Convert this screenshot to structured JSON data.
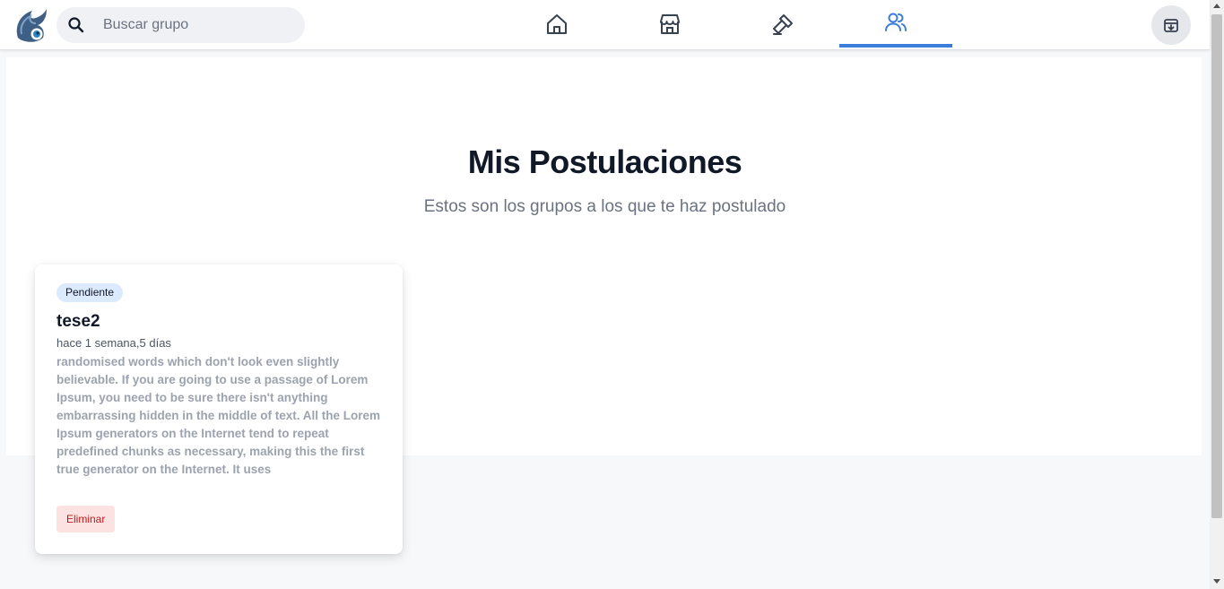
{
  "navbar": {
    "logo_icon": "dragon-logo-icon",
    "search": {
      "placeholder": "Buscar grupo",
      "value": ""
    },
    "tabs": [
      {
        "icon": "home-icon",
        "active": false
      },
      {
        "icon": "store-icon",
        "active": false
      },
      {
        "icon": "hammer-icon",
        "active": false
      },
      {
        "icon": "users-icon",
        "active": true
      }
    ],
    "archive_icon": "archive-icon"
  },
  "main": {
    "title": "Mis Postulaciones",
    "subtitle": "Estos son los grupos a los que te haz postulado"
  },
  "applications": [
    {
      "status": "Pendiente",
      "name": "tese2",
      "time": "hace 1 semana,5 días",
      "description": "randomised words which don't look even slightly believable. If you are going to use a passage of Lorem Ipsum, you need to be sure there isn't anything embarrassing hidden in the middle of text. All the Lorem Ipsum generators on the Internet tend to repeat predefined chunks as necessary, making this the first true generator on the Internet. It uses",
      "delete_label": "Eliminar"
    }
  ],
  "colors": {
    "accent": "#3b7dd8",
    "badge_bg": "#dbeafe",
    "delete_bg": "#fde2e2",
    "delete_text": "#b91c1c"
  }
}
